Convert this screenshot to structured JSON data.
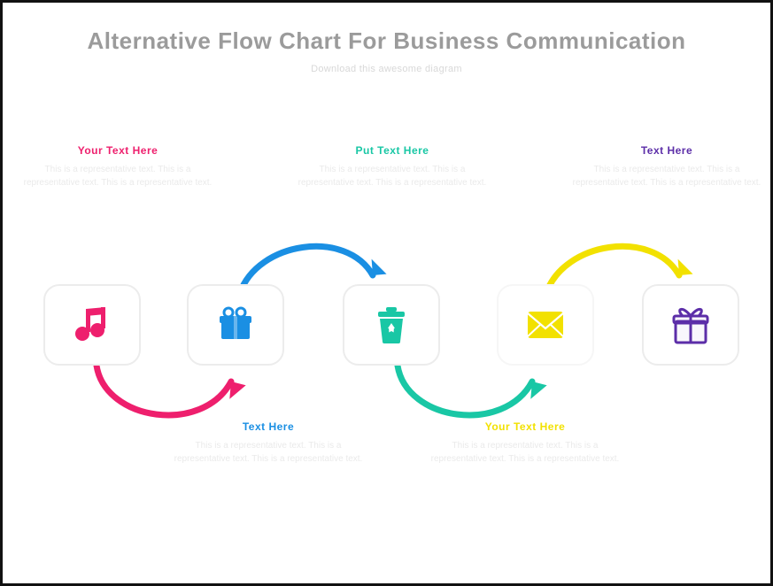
{
  "title": "Alternative Flow Chart For Business Communication",
  "subtitle": "Download this awesome diagram",
  "palette": {
    "pink": "#ee1f6d",
    "blue": "#1a8fe3",
    "teal": "#19c7a5",
    "yellow": "#f2e100",
    "purple": "#5c2ea8"
  },
  "text_blocks": {
    "top": [
      {
        "heading": "Your Text Here",
        "color": "pink",
        "body": "This is a representative text. This is a representative text. This is a representative text."
      },
      {
        "heading": "Put Text Here",
        "color": "teal",
        "body": "This is a representative text. This is a representative text. This is a representative text."
      },
      {
        "heading": "Text Here",
        "color": "purple",
        "body": "This is a representative text. This is a representative text. This is a representative text."
      }
    ],
    "bottom": [
      {
        "heading": "Text Here",
        "color": "blue",
        "body": "This is a representative text. This is a representative text. This is a representative text."
      },
      {
        "heading": "Your Text Here",
        "color": "yellow",
        "body": "This is a representative text. This is a representative text. This is a representative text."
      }
    ]
  },
  "flow": {
    "steps": [
      {
        "icon": "music",
        "color": "pink"
      },
      {
        "icon": "gift",
        "color": "blue"
      },
      {
        "icon": "recycle",
        "color": "teal"
      },
      {
        "icon": "mail",
        "color": "yellow"
      },
      {
        "icon": "present",
        "color": "purple"
      }
    ],
    "connectors": [
      {
        "from": 1,
        "to": 2,
        "position": "bottom",
        "color": "pink"
      },
      {
        "from": 2,
        "to": 3,
        "position": "top",
        "color": "blue"
      },
      {
        "from": 3,
        "to": 4,
        "position": "bottom",
        "color": "teal"
      },
      {
        "from": 4,
        "to": 5,
        "position": "top",
        "color": "yellow"
      }
    ]
  }
}
